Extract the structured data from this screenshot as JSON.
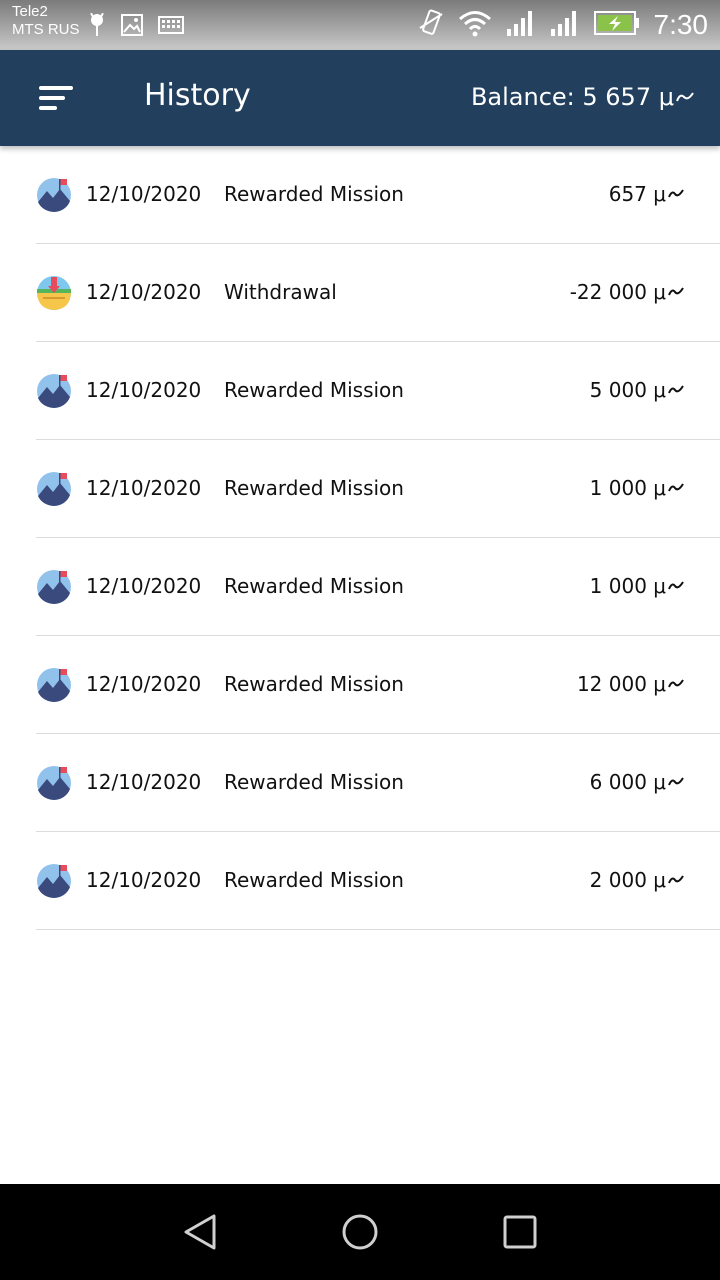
{
  "status_bar": {
    "carrier_1": "Tele2",
    "carrier_2": "MTS RUS",
    "time": "7:30",
    "icons": [
      "android-debug-icon",
      "gallery-icon",
      "keyboard-icon",
      "vibrate-icon",
      "wifi-icon",
      "signal-icon",
      "signal-icon",
      "battery-charging-icon"
    ]
  },
  "app_bar": {
    "title": "History",
    "balance_label": "Balance: 5 657 μ",
    "menu_icon": "sort-menu-icon",
    "background": "#22405d"
  },
  "history": {
    "rows": [
      {
        "icon": "mission-icon",
        "date": "12/10/2020",
        "type": "Rewarded Mission",
        "amount": "657 μ"
      },
      {
        "icon": "withdrawal-icon",
        "date": "12/10/2020",
        "type": "Withdrawal",
        "amount": "-22 000 μ"
      },
      {
        "icon": "mission-icon",
        "date": "12/10/2020",
        "type": "Rewarded Mission",
        "amount": "5 000 μ"
      },
      {
        "icon": "mission-icon",
        "date": "12/10/2020",
        "type": "Rewarded Mission",
        "amount": "1 000 μ"
      },
      {
        "icon": "mission-icon",
        "date": "12/10/2020",
        "type": "Rewarded Mission",
        "amount": "1 000 μ"
      },
      {
        "icon": "mission-icon",
        "date": "12/10/2020",
        "type": "Rewarded Mission",
        "amount": "12 000 μ"
      },
      {
        "icon": "mission-icon",
        "date": "12/10/2020",
        "type": "Rewarded Mission",
        "amount": "6 000 μ"
      },
      {
        "icon": "mission-icon",
        "date": "12/10/2020",
        "type": "Rewarded Mission",
        "amount": "2 000 μ"
      }
    ]
  },
  "nav_bar": {
    "buttons": [
      "back-icon",
      "home-icon",
      "recents-icon"
    ]
  }
}
